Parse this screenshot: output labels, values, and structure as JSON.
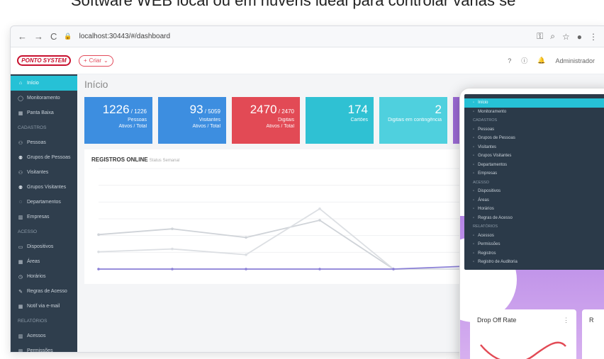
{
  "caption": "Software WEB local ou em nuvens ideal para controlar várias se",
  "browser": {
    "url": "localhost:30443/#/dashboard",
    "nav_back": "←",
    "nav_forward": "→",
    "nav_reload": "C"
  },
  "app": {
    "logo": "PONTO SYSTEM",
    "criar_label": "Criar",
    "user": "Administrador",
    "page_title": "Início",
    "sidebar": {
      "items": [
        {
          "label": "Início",
          "type": "item",
          "icon": "home",
          "active": true
        },
        {
          "label": "Monitoramento",
          "type": "item",
          "icon": "monitor"
        },
        {
          "label": "Panta Baixa",
          "type": "item",
          "icon": "grid"
        },
        {
          "label": "CADASTROS",
          "type": "head"
        },
        {
          "label": "Pessoas",
          "type": "item",
          "icon": "user"
        },
        {
          "label": "Grupos de Pessoas",
          "type": "item",
          "icon": "group"
        },
        {
          "label": "Visitantes",
          "type": "item",
          "icon": "user"
        },
        {
          "label": "Grupos Visitantes",
          "type": "item",
          "icon": "group"
        },
        {
          "label": "Departamentos",
          "type": "item",
          "icon": "dept"
        },
        {
          "label": "Empresas",
          "type": "item",
          "icon": "bar"
        },
        {
          "label": "ACESSO",
          "type": "head"
        },
        {
          "label": "Dispositivos",
          "type": "item",
          "icon": "device"
        },
        {
          "label": "Áreas",
          "type": "item",
          "icon": "grid"
        },
        {
          "label": "Horários",
          "type": "item",
          "icon": "clock"
        },
        {
          "label": "Regras de Acesso",
          "type": "item",
          "icon": "rule"
        },
        {
          "label": "Notif via e-mail",
          "type": "item",
          "icon": "grid"
        },
        {
          "label": "RELATÓRIOS",
          "type": "head"
        },
        {
          "label": "Acessos",
          "type": "item",
          "icon": "bar"
        },
        {
          "label": "Permissões",
          "type": "item",
          "icon": "bar"
        }
      ]
    },
    "cards": [
      {
        "big": "1226",
        "small": "/ 1226",
        "sub1": "Pessoas",
        "sub2": "Ativos / Total",
        "color": "#3d8ee0"
      },
      {
        "big": "93",
        "small": "/ 5059",
        "sub1": "Visitantes",
        "sub2": "Ativos / Total",
        "color": "#3d8ee0"
      },
      {
        "big": "2470",
        "small": "/ 2470",
        "sub1": "Digitais",
        "sub2": "Ativos / Total",
        "color": "#e24a55"
      },
      {
        "big": "174",
        "small": "",
        "sub1": "Cartões",
        "sub2": "",
        "color": "#2fc1d3"
      },
      {
        "big": "2",
        "small": "",
        "sub1": "Digitais em contingência",
        "sub2": "",
        "color": "#4fd0de"
      }
    ],
    "chart": {
      "title": "REGISTROS ONLINE",
      "subtitle": "Status Semanal"
    }
  },
  "chart_data": {
    "type": "line",
    "categories": [
      "",
      "",
      "",
      "",
      "",
      ""
    ],
    "ylim": [
      0,
      35
    ],
    "series": [
      {
        "values": [
          12,
          14,
          11,
          17,
          0,
          0
        ]
      },
      {
        "values": [
          6,
          7,
          5,
          21,
          0,
          0
        ]
      },
      {
        "values": [
          0,
          0,
          0,
          0,
          0,
          1
        ]
      }
    ],
    "colors": [
      "#cfd3d8",
      "#dcdfe3",
      "#8a7fd6"
    ]
  },
  "phone": {
    "menu": [
      {
        "label": "Início",
        "type": "item",
        "active": true
      },
      {
        "label": "Monitoramento",
        "type": "item"
      },
      {
        "label": "CADASTROS",
        "type": "head"
      },
      {
        "label": "Pessoas",
        "type": "item"
      },
      {
        "label": "Grupos de Pessoas",
        "type": "item"
      },
      {
        "label": "Visitantes",
        "type": "item"
      },
      {
        "label": "Grupos Visitantes",
        "type": "item"
      },
      {
        "label": "Departamentos",
        "type": "item"
      },
      {
        "label": "Empresas",
        "type": "item"
      },
      {
        "label": "ACESSO",
        "type": "head"
      },
      {
        "label": "Dispositivos",
        "type": "item"
      },
      {
        "label": "Áreas",
        "type": "item"
      },
      {
        "label": "Horários",
        "type": "item"
      },
      {
        "label": "Regras de Acesso",
        "type": "item"
      },
      {
        "label": "RELATÓRIOS",
        "type": "head"
      },
      {
        "label": "Acessos",
        "type": "item"
      },
      {
        "label": "Permissões",
        "type": "item"
      },
      {
        "label": "Registros",
        "type": "item"
      },
      {
        "label": "Registro de Auditoria",
        "type": "item"
      }
    ],
    "drop_card_title": "Drop Off Rate",
    "drop_card2_title": "R"
  }
}
